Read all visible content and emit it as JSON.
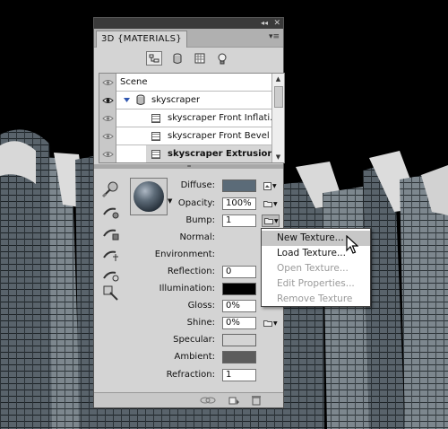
{
  "panel": {
    "tab_title": "3D {MATERIALS}",
    "collapse_glyph": "◂◂",
    "close_glyph": "✕",
    "menu_glyph": "▾≡",
    "filter_icons": [
      "scene-filter-icon",
      "mesh-filter-icon",
      "material-filter-icon",
      "light-filter-icon"
    ]
  },
  "scene_list": {
    "rows": [
      {
        "label": "Scene"
      },
      {
        "label": "skyscraper"
      },
      {
        "label": "skyscraper Front Inflati..."
      },
      {
        "label": "skyscraper Front Bevel ..."
      },
      {
        "label": "skyscraper Extrusion..."
      }
    ],
    "selected_index": 4
  },
  "properties": {
    "diffuse": {
      "label": "Diffuse:",
      "color": "#5b6b78"
    },
    "opacity": {
      "label": "Opacity:",
      "value": "100%"
    },
    "bump": {
      "label": "Bump:",
      "value": "1"
    },
    "normal": {
      "label": "Normal:"
    },
    "environment": {
      "label": "Environment:"
    },
    "reflection": {
      "label": "Reflection:",
      "value": "0"
    },
    "illumination": {
      "label": "Illumination:",
      "color": "#000000"
    },
    "gloss": {
      "label": "Gloss:",
      "value": "0%"
    },
    "shine": {
      "label": "Shine:",
      "value": "0%"
    },
    "specular": {
      "label": "Specular:",
      "color": "#d4d4d4"
    },
    "ambient": {
      "label": "Ambient:",
      "color": "#5c5c5c"
    },
    "refraction": {
      "label": "Refraction:",
      "value": "1"
    }
  },
  "context_menu": {
    "items": [
      {
        "label": "New Texture...",
        "enabled": true,
        "highlighted": true
      },
      {
        "label": "Load Texture...",
        "enabled": true
      },
      {
        "label": "Open Texture...",
        "enabled": false
      },
      {
        "label": "Edit Properties...",
        "enabled": false
      },
      {
        "label": "Remove Texture",
        "enabled": false
      }
    ]
  },
  "colors": {
    "panel_bg": "#d4d4d4",
    "highlight": "#c7c7c7",
    "building": "#3e464c"
  }
}
